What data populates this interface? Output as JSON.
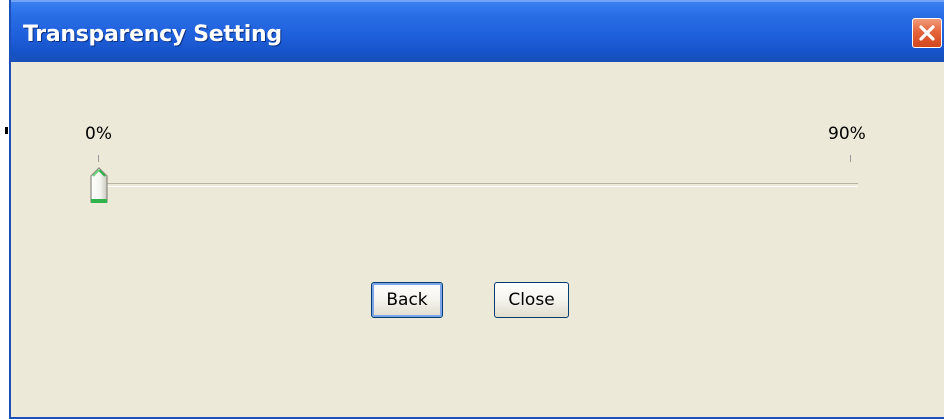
{
  "window": {
    "title": "Transparency Setting",
    "close_icon": "close-x-icon"
  },
  "slider": {
    "min_label": "0%",
    "max_label": "90%",
    "value_fraction": 0.0
  },
  "buttons": {
    "back_label": "Back",
    "close_label": "Close"
  },
  "colors": {
    "title_bar": "#1f60dc",
    "dialog_bg": "#ece9d8",
    "close_button": "#e5653c",
    "thumb_accent": "#2fb34a"
  }
}
